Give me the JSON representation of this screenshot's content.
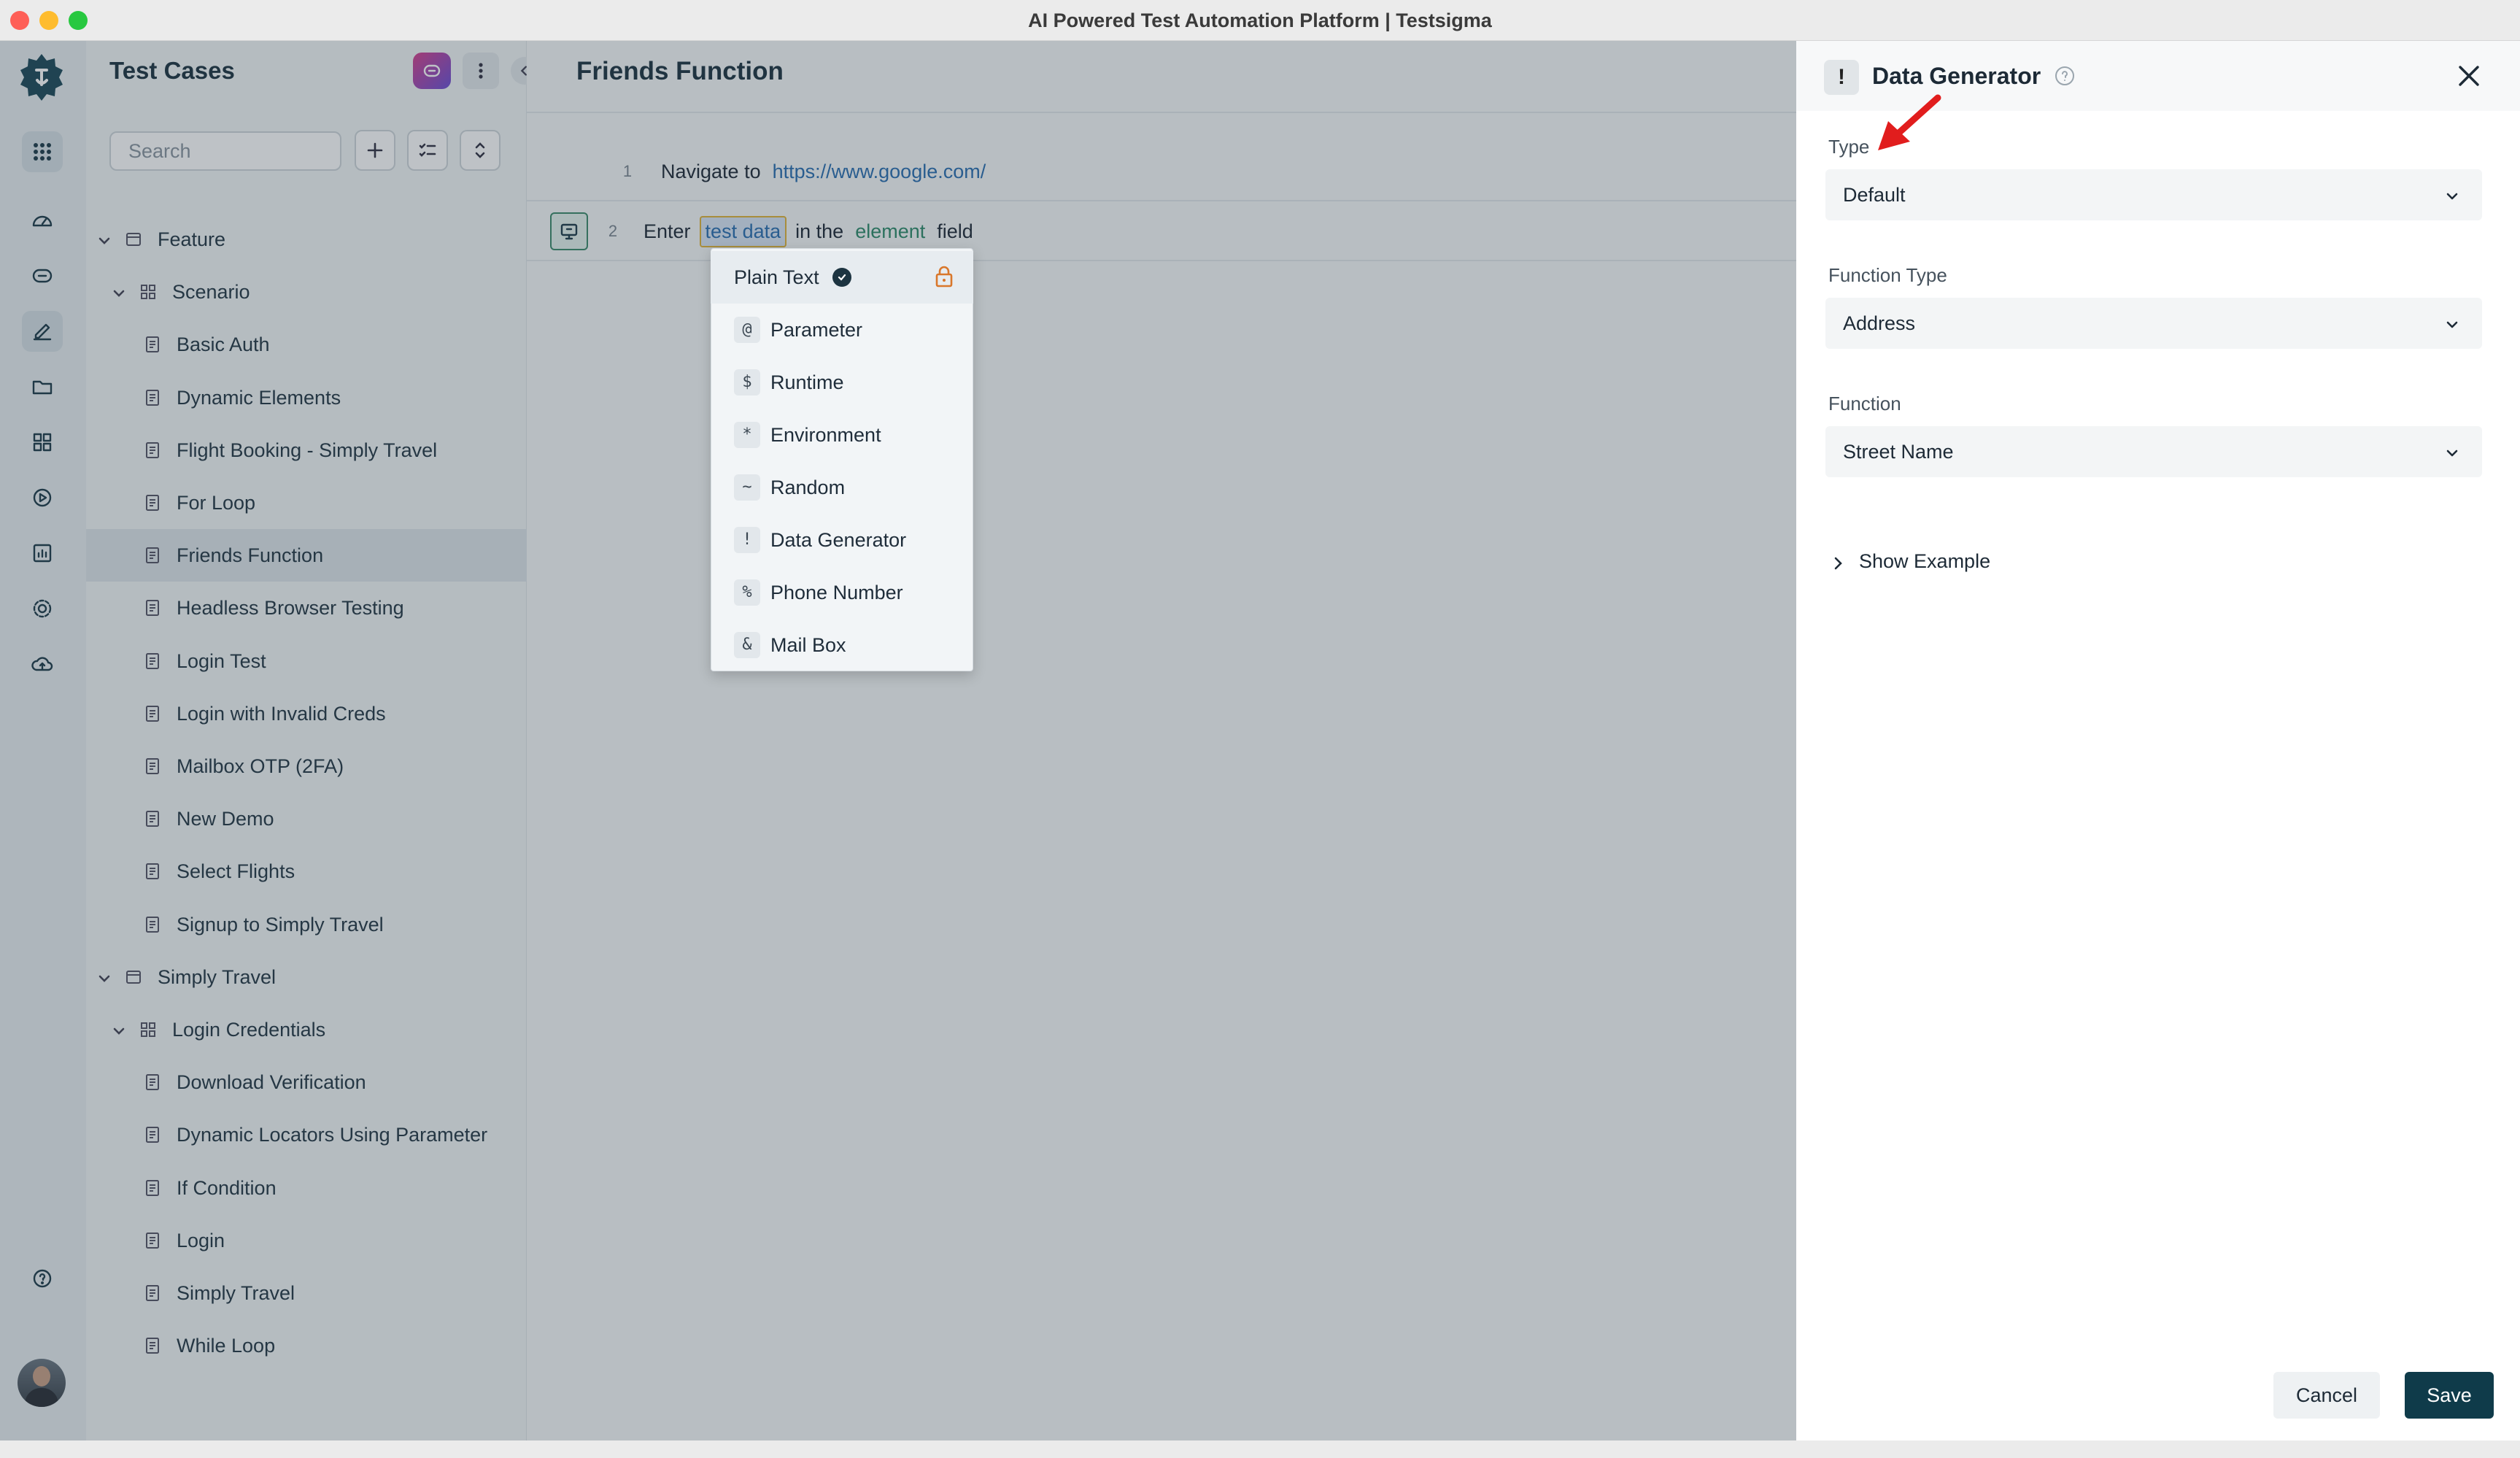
{
  "window": {
    "title": "AI Powered Test Automation Platform | Testsigma"
  },
  "sidebar": {
    "title": "Test Cases",
    "search_placeholder": "Search",
    "tree": [
      {
        "label": "Feature",
        "level": 0,
        "type": "feature",
        "expanded": true
      },
      {
        "label": "Scenario",
        "level": 1,
        "type": "scenario",
        "expanded": true
      },
      {
        "label": "Basic Auth",
        "level": 2,
        "type": "case"
      },
      {
        "label": "Dynamic Elements",
        "level": 2,
        "type": "case"
      },
      {
        "label": "Flight Booking - Simply Travel",
        "level": 2,
        "type": "case"
      },
      {
        "label": "For Loop",
        "level": 2,
        "type": "case"
      },
      {
        "label": "Friends Function",
        "level": 2,
        "type": "case",
        "selected": true
      },
      {
        "label": "Headless Browser Testing",
        "level": 2,
        "type": "case"
      },
      {
        "label": "Login Test",
        "level": 2,
        "type": "case"
      },
      {
        "label": "Login with Invalid Creds",
        "level": 2,
        "type": "case"
      },
      {
        "label": "Mailbox OTP (2FA)",
        "level": 2,
        "type": "case"
      },
      {
        "label": "New Demo",
        "level": 2,
        "type": "case"
      },
      {
        "label": "Select Flights",
        "level": 2,
        "type": "case"
      },
      {
        "label": "Signup to Simply Travel",
        "level": 2,
        "type": "case"
      },
      {
        "label": "Simply Travel",
        "level": 0,
        "type": "feature",
        "expanded": true
      },
      {
        "label": "Login Credentials",
        "level": 1,
        "type": "scenario",
        "expanded": true
      },
      {
        "label": "Download Verification",
        "level": 2,
        "type": "case"
      },
      {
        "label": "Dynamic Locators Using Parameter",
        "level": 2,
        "type": "case"
      },
      {
        "label": "If Condition",
        "level": 2,
        "type": "case"
      },
      {
        "label": "Login",
        "level": 2,
        "type": "case"
      },
      {
        "label": "Simply Travel",
        "level": 2,
        "type": "case"
      },
      {
        "label": "While Loop",
        "level": 2,
        "type": "case"
      }
    ]
  },
  "main": {
    "title": "Friends Function",
    "steps": [
      {
        "num": "1",
        "action": "Navigate to",
        "url": "https://www.google.com/"
      },
      {
        "num": "2",
        "action": "Enter",
        "data": "test data",
        "middle": "in the",
        "element": "element",
        "suffix": "field"
      }
    ]
  },
  "data_type_menu": {
    "items": [
      {
        "symbol": "",
        "label": "Plain Text",
        "checked": true,
        "locked": true
      },
      {
        "symbol": "@",
        "label": "Parameter"
      },
      {
        "symbol": "$",
        "label": "Runtime"
      },
      {
        "symbol": "*",
        "label": "Environment"
      },
      {
        "symbol": "~",
        "label": "Random"
      },
      {
        "symbol": "!",
        "label": "Data Generator"
      },
      {
        "symbol": "%",
        "label": "Phone Number"
      },
      {
        "symbol": "&",
        "label": "Mail Box"
      }
    ]
  },
  "panel": {
    "badge": "!",
    "title": "Data Generator",
    "type_label": "Type",
    "type_value": "Default",
    "function_type_label": "Function Type",
    "function_type_value": "Address",
    "function_label": "Function",
    "function_value": "Street Name",
    "show_example": "Show Example",
    "cancel": "Cancel",
    "save": "Save"
  },
  "colors": {
    "accent": "#0f3b4a",
    "link": "#2a6fb0",
    "element": "#2e8b6a",
    "annotation_arrow": "#e11d1d"
  }
}
